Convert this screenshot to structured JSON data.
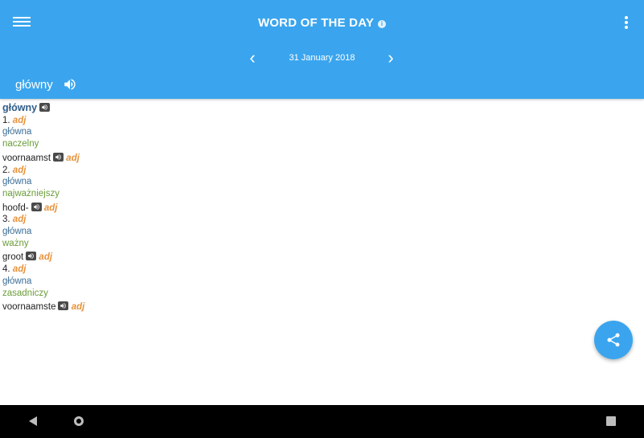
{
  "header": {
    "title": "WORD OF THE DAY",
    "date": "31 January 2018",
    "word": "główny"
  },
  "entry": {
    "headword": "główny",
    "senses": [
      {
        "number": "1.",
        "pos": "adj",
        "form": "główna",
        "synonym": "naczelny",
        "translation": "voornaamst",
        "translation_pos": "adj"
      },
      {
        "number": "2.",
        "pos": "adj",
        "form": "główna",
        "synonym": "najważniejszy",
        "translation": "hoofd-",
        "translation_pos": "adj"
      },
      {
        "number": "3.",
        "pos": "adj",
        "form": "główna",
        "synonym": "ważny",
        "translation": "groot",
        "translation_pos": "adj"
      },
      {
        "number": "4.",
        "pos": "adj",
        "form": "główna",
        "synonym": "zasadniczy",
        "translation": "voornaamste",
        "translation_pos": "adj"
      }
    ]
  },
  "icons": {
    "menu": "hamburger-menu-icon",
    "info": "info-icon",
    "more": "more-vert-icon",
    "prev": "chevron-left-icon",
    "next": "chevron-right-icon",
    "speaker": "speaker-icon",
    "share": "share-icon"
  },
  "colors": {
    "primary": "#3aa5ee",
    "headword": "#2f5c88",
    "pos": "#e8923b",
    "form": "#3a6d96",
    "synonym": "#6a9d39"
  }
}
